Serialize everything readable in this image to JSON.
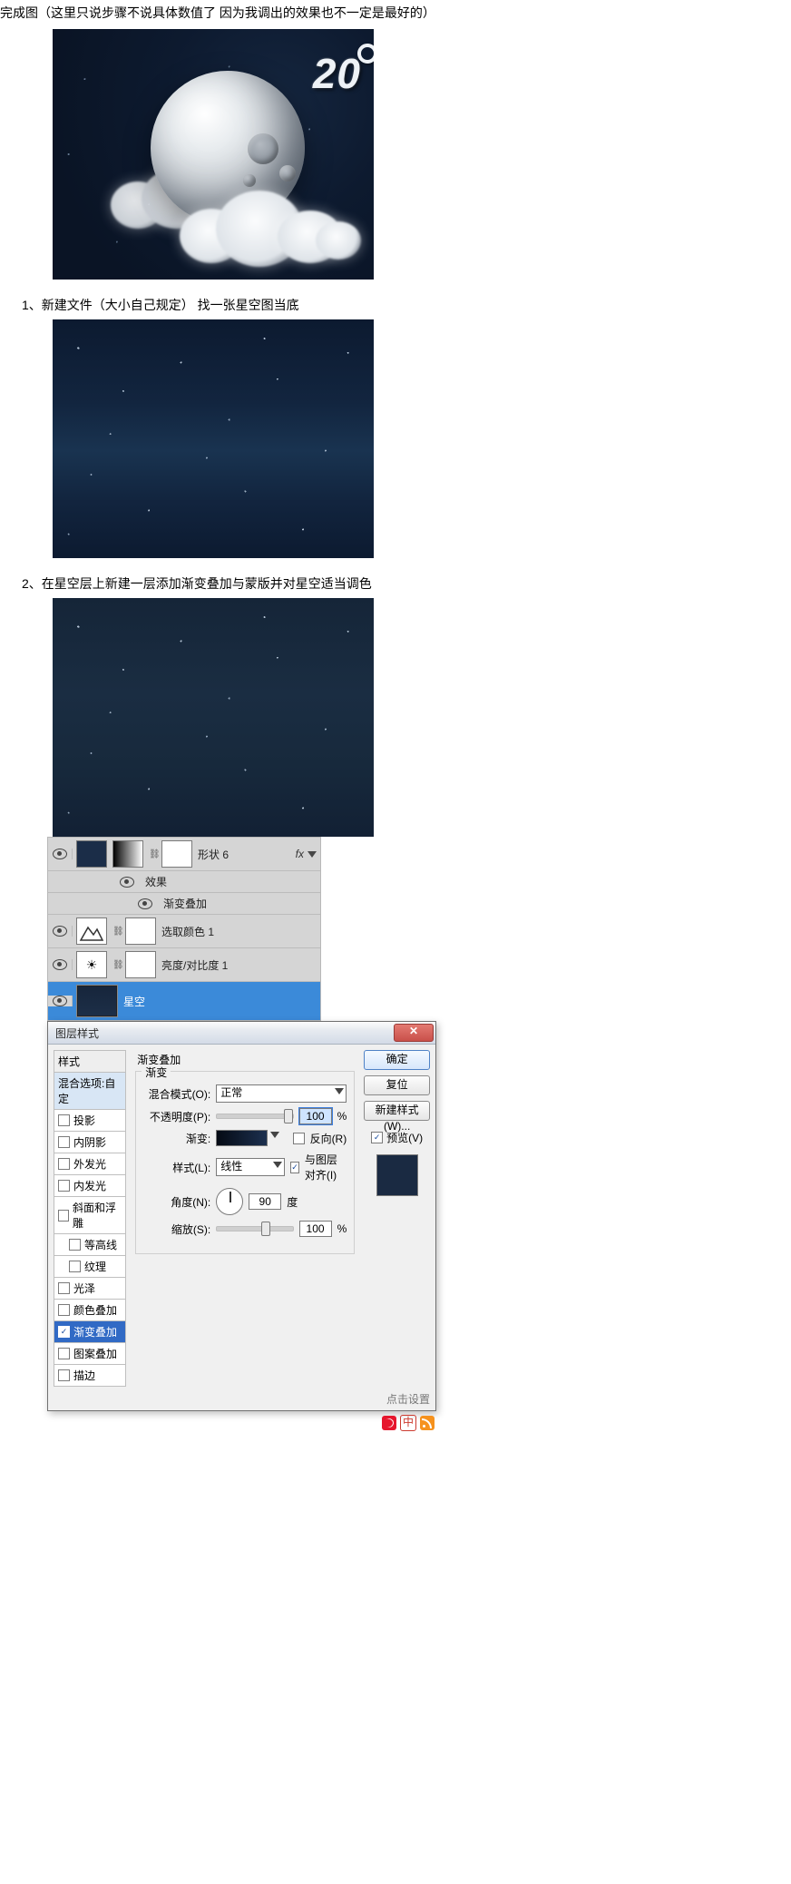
{
  "intro": "完成图（这里只说步骤不说具体数值了 因为我调出的效果也不一定是最好的）",
  "temperature": "20",
  "steps": {
    "s1": "1、新建文件（大小自己规定）    找一张星空图当底",
    "s2": "2、在星空层上新建一层添加渐变叠加与蒙版并对星空适当调色"
  },
  "layers_panel": {
    "shape6": "形状 6",
    "fx": "fx",
    "effects": "效果",
    "grad_overlay": "渐变叠加",
    "selective_color": "选取颜色 1",
    "brightness_contrast": "亮度/对比度 1",
    "sky": "星空"
  },
  "layer_style": {
    "title": "图层样式",
    "left": {
      "styles": "样式",
      "blend_default": "混合选项:自定",
      "drop_shadow": "投影",
      "inner_shadow": "内阴影",
      "outer_glow": "外发光",
      "inner_glow": "内发光",
      "bevel": "斜面和浮雕",
      "contour": "等高线",
      "texture": "纹理",
      "satin": "光泽",
      "color_overlay": "颜色叠加",
      "gradient_overlay": "渐变叠加",
      "pattern_overlay": "图案叠加",
      "stroke": "描边"
    },
    "center": {
      "section": "渐变叠加",
      "group": "渐变",
      "blend_mode_label": "混合模式(O):",
      "blend_mode_value": "正常",
      "opacity_label": "不透明度(P):",
      "opacity_value": "100",
      "percent": "%",
      "gradient_label": "渐变:",
      "reverse": "反向(R)",
      "style_label": "样式(L):",
      "style_value": "线性",
      "align_layer": "与图层对齐(I)",
      "angle_label": "角度(N):",
      "angle_value": "90",
      "angle_unit": "度",
      "scale_label": "缩放(S):",
      "scale_value": "100"
    },
    "right": {
      "ok": "确定",
      "reset": "复位",
      "new_style": "新建样式(W)...",
      "preview": "预览(V)"
    },
    "footer": "点击设置"
  },
  "share": {
    "chn": "中"
  }
}
